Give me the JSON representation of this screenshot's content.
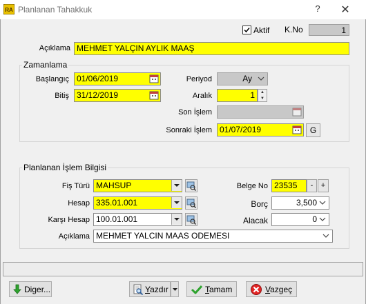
{
  "window": {
    "title": "Planlanan Tahakkuk",
    "icon_text": "RA",
    "help_label": "?",
    "close_label": "✕"
  },
  "header": {
    "aktif_label": "Aktif",
    "aktif_checked": true,
    "kno_label": "K.No",
    "kno_value": "1",
    "aciklama_label": "Açıklama",
    "aciklama_value": "MEHMET YALÇIN AYLIK MAAŞ"
  },
  "zamanlama": {
    "title": "Zamanlama",
    "baslangic_label": "Başlangıç",
    "baslangic_value": "01/06/2019",
    "bitis_label": "Bitiş",
    "bitis_value": "31/12/2019",
    "periyod_label": "Periyod",
    "periyod_value": "Ay",
    "aralik_label": "Aralık",
    "aralik_value": "1",
    "son_islem_label": "Son İşlem",
    "son_islem_value": "",
    "sonraki_islem_label": "Sonraki İşlem",
    "sonraki_islem_value": "01/07/2019",
    "g_button_label": "G"
  },
  "islem": {
    "title": "Planlanan İşlem Bilgisi",
    "fis_turu_label": "Fiş Türü",
    "fis_turu_value": "MAHSUP",
    "hesap_label": "Hesap",
    "hesap_value": "335.01.001",
    "karsi_hesap_label": "Karşı Hesap",
    "karsi_hesap_value": "100.01.001",
    "aciklama_label": "Açıklama",
    "aciklama_value": "MEHMET YALCIN MAAS ODEMESI",
    "belge_no_label": "Belge No",
    "belge_no_value": "23535",
    "minus_label": "-",
    "plus_label": "+",
    "borc_label": "Borç",
    "borc_value": "3,500",
    "alacak_label": "Alacak",
    "alacak_value": "0"
  },
  "buttons": {
    "diger_pre": "Di",
    "diger_u": "g",
    "diger_post": "er...",
    "yazdir_pre": "",
    "yazdir_u": "Y",
    "yazdir_post": "azdır",
    "tamam_pre": "",
    "tamam_u": "T",
    "tamam_post": "amam",
    "vazgec_pre": "",
    "vazgec_u": "V",
    "vazgec_post": "azgeç"
  },
  "colors": {
    "required_field": "#ffff00",
    "disabled_field": "#c8c8c8"
  }
}
